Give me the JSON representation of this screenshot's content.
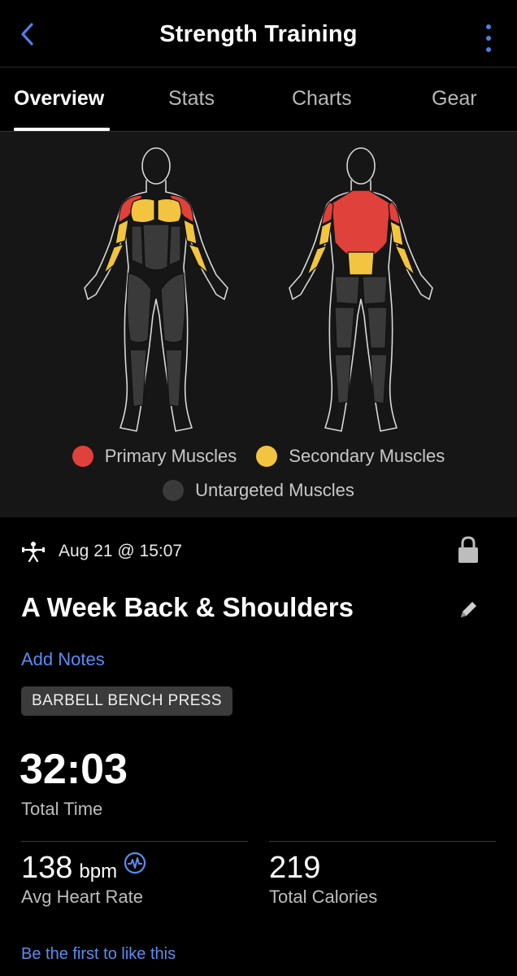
{
  "header": {
    "title": "Strength Training"
  },
  "tabs": [
    {
      "label": "Overview",
      "active": true
    },
    {
      "label": "Stats",
      "active": false
    },
    {
      "label": "Charts",
      "active": false
    },
    {
      "label": "Gear",
      "active": false
    }
  ],
  "legend": {
    "primary": "Primary Muscles",
    "secondary": "Secondary Muscles",
    "untargeted": "Untargeted Muscles"
  },
  "colors": {
    "primary": "#e0413a",
    "secondary": "#f2c43f",
    "untargeted": "#3a3a3a",
    "accent": "#4d7fe8",
    "link": "#5b8df0"
  },
  "activity": {
    "datetime": "Aug 21 @ 15:07",
    "name": "A Week Back & Shoulders",
    "add_notes": "Add Notes",
    "exercise_tag": "BARBELL BENCH PRESS"
  },
  "stats": {
    "total_time": {
      "value": "32:03",
      "label": "Total Time"
    },
    "heart_rate": {
      "value": "138",
      "unit": "bpm",
      "label": "Avg Heart Rate"
    },
    "calories": {
      "value": "219",
      "label": "Total Calories"
    }
  },
  "social": {
    "like_text": "Be the first to like this"
  },
  "icons": {
    "back": "chevron-left-icon",
    "menu": "more-vertical-icon",
    "activity": "strength-activity-icon",
    "lock": "lock-icon",
    "edit": "pencil-icon",
    "heart_rate": "heart-rate-icon"
  }
}
